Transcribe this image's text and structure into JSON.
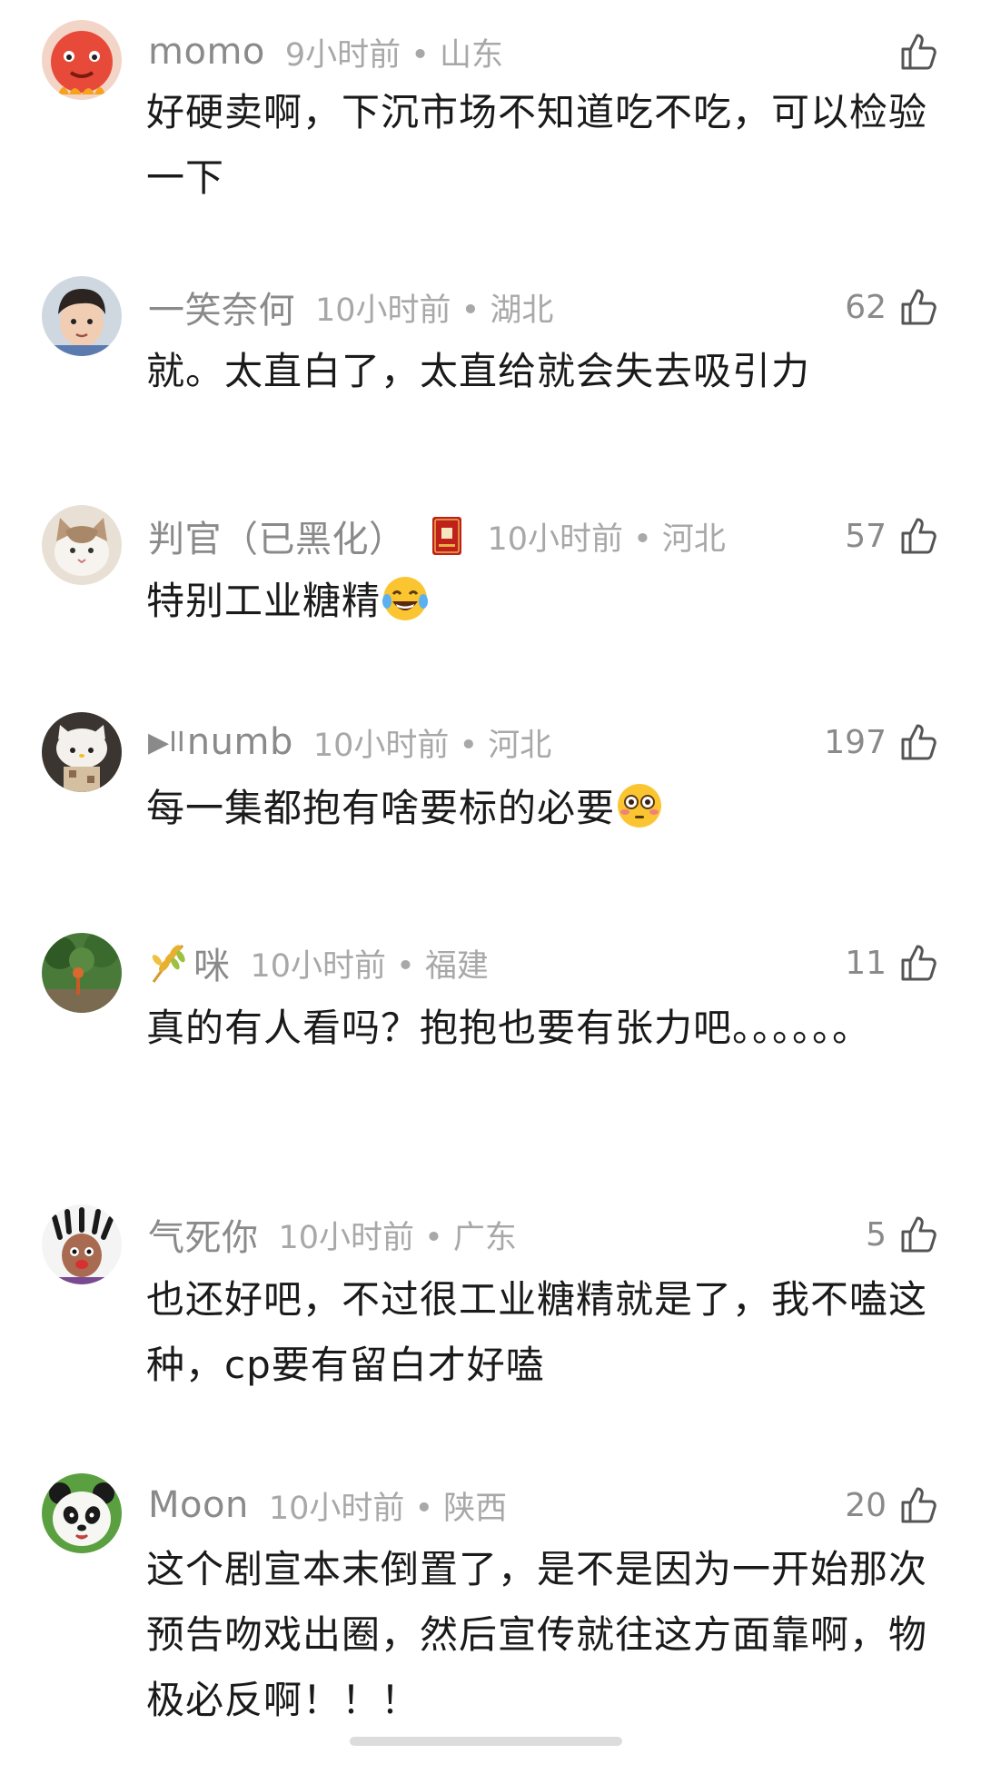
{
  "comments": [
    {
      "username": "momo",
      "meta": "9小时前 • 山东",
      "likes": "",
      "avatar_icon": "red-cartoon-avatar",
      "text": "好硬卖啊，下沉市场不知道吃不吃，可以检验一下"
    },
    {
      "username": "一笑奈何",
      "meta": "10小时前 • 湖北",
      "likes": "62",
      "avatar_icon": "boy-photo-avatar",
      "text": "就。太直白了，太直给就会失去吸引力"
    },
    {
      "username": "判官（已黑化）",
      "meta": "10小时前 • 河北",
      "likes": "57",
      "avatar_icon": "cat-photo-avatar",
      "badge_icon": "red-book-badge-icon",
      "text": "特别工业糖精",
      "emoji": "laughing-tears-emoji"
    },
    {
      "username": "numb",
      "username_prefix": "▶II",
      "meta": "10小时前 • 河北",
      "likes": "197",
      "avatar_icon": "hello-kitty-avatar",
      "text": "每一集都抱有啥要标的必要",
      "emoji": "flushed-face-emoji"
    },
    {
      "username": "咪",
      "meta": "10小时前 • 福建",
      "likes": "11",
      "avatar_icon": "outdoor-photo-avatar",
      "name_icon": "wheat-icon",
      "text": "真的有人看吗？抱抱也要有张力吧。。。。。。"
    },
    {
      "username": "气死你",
      "meta": "10小时前 • 广东",
      "likes": "5",
      "avatar_icon": "cartoon-face-avatar",
      "text": "也还好吧，不过很工业糖精就是了，我不嗑这种，cp要有留白才好嗑"
    },
    {
      "username": "Moon",
      "meta": "10小时前 • 陕西",
      "likes": "20",
      "avatar_icon": "panda-avatar",
      "text": "这个剧宣本末倒置了，是不是因为一开始那次预告吻戏出圈，然后宣传就往这方面靠啊，物极必反啊！！！"
    }
  ],
  "colors": {
    "text": "#1a1a1a",
    "username": "#8a8a8a",
    "meta": "#a8a8a8",
    "background": "#ffffff"
  }
}
